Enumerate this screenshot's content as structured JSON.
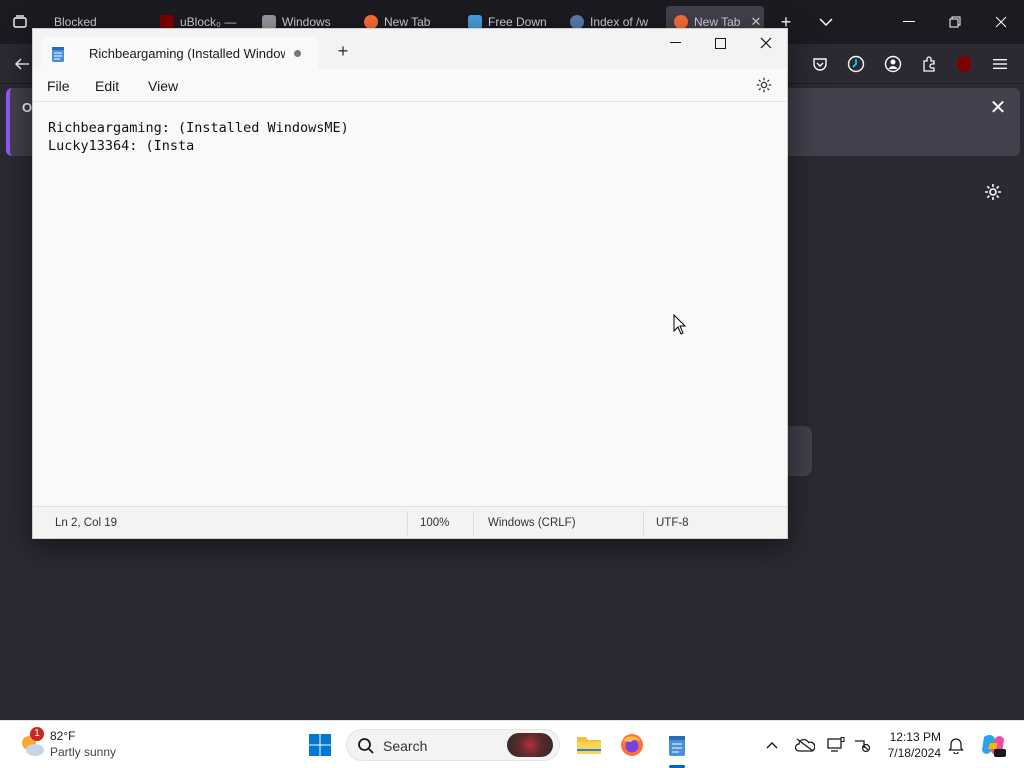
{
  "browser": {
    "tabs": [
      {
        "label": "Blocked",
        "icon": "page-icon"
      },
      {
        "label": "uBlock₀ —",
        "icon": "ublock-icon"
      },
      {
        "label": "Windows",
        "icon": "trash-icon"
      },
      {
        "label": "New Tab",
        "icon": "firefox-icon"
      },
      {
        "label": "Free Down",
        "icon": "download-page-icon"
      },
      {
        "label": "Index of /w",
        "icon": "globe-icon"
      },
      {
        "label": "New Tab",
        "icon": "firefox-icon"
      }
    ],
    "notice_label_fragment": "O"
  },
  "notepad": {
    "tab_title": "Richbeargaming (Installed Window",
    "menu": {
      "file": "File",
      "edit": "Edit",
      "view": "View"
    },
    "content_lines": [
      "Richbeargaming: (Installed WindowsME)",
      "Lucky13364: (Insta"
    ],
    "status": {
      "position": "Ln 2, Col 19",
      "zoom": "100%",
      "line_ending": "Windows (CRLF)",
      "encoding": "UTF-8"
    }
  },
  "taskbar": {
    "weather_temp": "82°F",
    "weather_desc": "Partly sunny",
    "weather_badge": "1",
    "search_label": "Search",
    "time": "12:13 PM",
    "date": "7/18/2024"
  },
  "colors": {
    "firefox_bg": "#2b2a33",
    "firefox_tabbar": "#1c1b22",
    "accent": "#0067c0",
    "notice_accent": "#9059ff"
  }
}
